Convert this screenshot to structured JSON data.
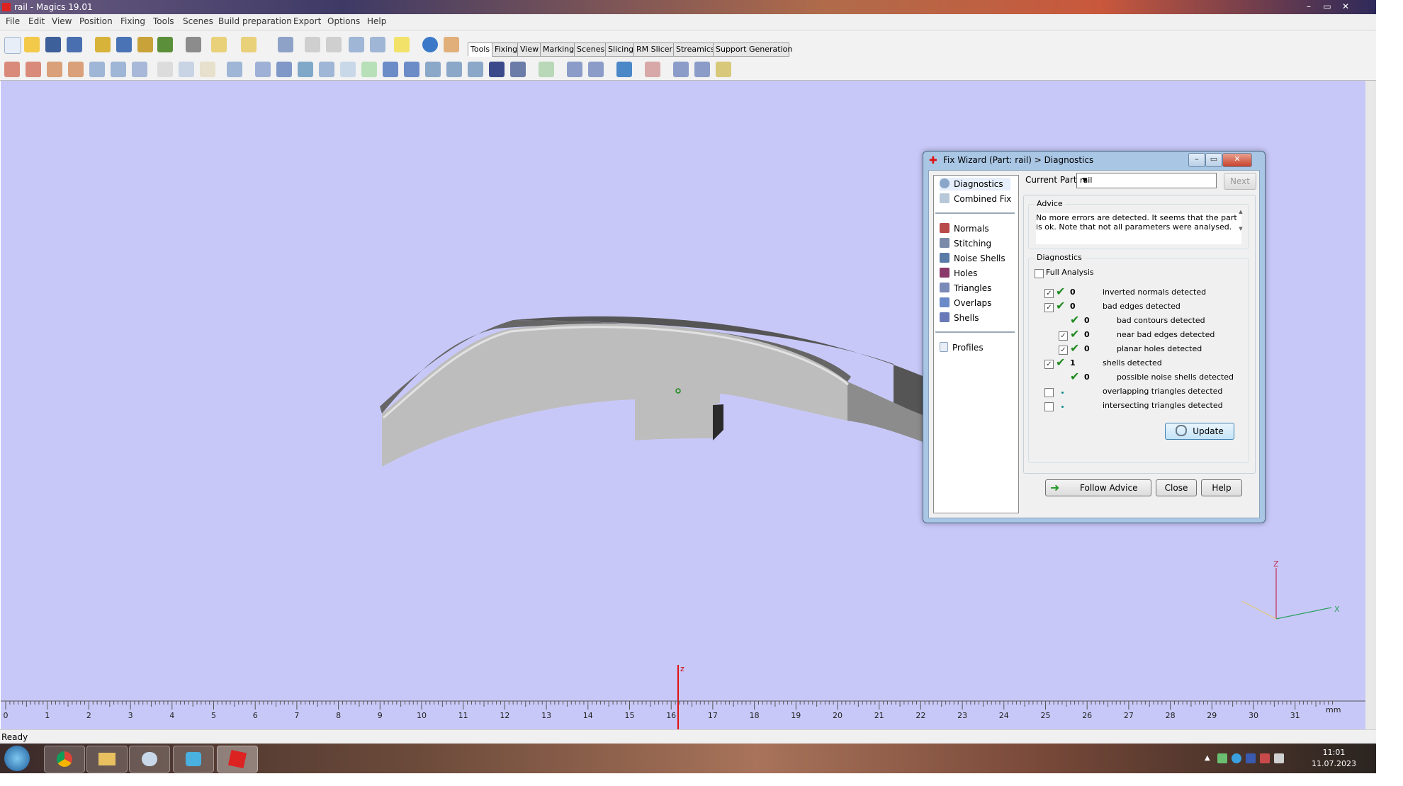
{
  "window": {
    "title": "rail - Magics 19.01"
  },
  "menu": [
    "File",
    "Edit",
    "View",
    "Position",
    "Fixing",
    "Tools",
    "Scenes",
    "Build preparation",
    "Export",
    "Options",
    "Help"
  ],
  "tabs": [
    "Tools",
    "Fixing",
    "View",
    "Marking",
    "Scenes",
    "Slicing",
    "RM Slicer",
    "Streamics",
    "Support Generation"
  ],
  "viewport": {
    "axis_label": "z",
    "triad": {
      "z": "Z",
      "x": "X"
    },
    "ruler_ticks": [
      "0",
      "1",
      "2",
      "3",
      "4",
      "5",
      "6",
      "7",
      "8",
      "9",
      "10",
      "11",
      "12",
      "13",
      "14",
      "15",
      "16",
      "17",
      "18",
      "19",
      "20",
      "21",
      "22",
      "23",
      "24",
      "25",
      "26",
      "27",
      "28",
      "29",
      "30",
      "31"
    ],
    "ruler_unit": "mm"
  },
  "status": {
    "text": "Ready"
  },
  "clock": {
    "time": "11:01",
    "date": "11.07.2023"
  },
  "dialog": {
    "title": "Fix Wizard (Part: rail) > Diagnostics",
    "nav": {
      "top": [
        "Diagnostics",
        "Combined Fix"
      ],
      "tools": [
        "Normals",
        "Stitching",
        "Noise Shells",
        "Holes",
        "Triangles",
        "Overlaps",
        "Shells"
      ],
      "bottom": [
        "Profiles"
      ]
    },
    "current_part_label": "Current Part:",
    "current_part_value": "rail",
    "next_label": "Next",
    "advice_title": "Advice",
    "advice_text": "No more errors are detected. It seems that the part is ok. Note that not all parameters were analysed.",
    "diagnostics_title": "Diagnostics",
    "full_analysis_label": "Full Analysis",
    "rows": [
      {
        "checked": true,
        "count": "0",
        "label": "inverted normals detected",
        "level": 0,
        "status": "ok"
      },
      {
        "checked": true,
        "count": "0",
        "label": "bad edges detected",
        "level": 0,
        "status": "ok"
      },
      {
        "checked": null,
        "count": "0",
        "label": "bad contours detected",
        "level": 1,
        "status": "ok"
      },
      {
        "checked": true,
        "count": "0",
        "label": "near bad edges detected",
        "level": 1,
        "status": "ok"
      },
      {
        "checked": true,
        "count": "0",
        "label": "planar holes detected",
        "level": 1,
        "status": "ok"
      },
      {
        "checked": true,
        "count": "1",
        "label": "shells detected",
        "level": 0,
        "status": "ok"
      },
      {
        "checked": null,
        "count": "0",
        "label": "possible noise shells detected",
        "level": 1,
        "status": "ok"
      },
      {
        "checked": false,
        "count": "",
        "label": "overlapping triangles detected",
        "level": 0,
        "status": "none"
      },
      {
        "checked": false,
        "count": "",
        "label": "intersecting triangles detected",
        "level": 0,
        "status": "none"
      }
    ],
    "update_label": "Update",
    "follow_advice_label": "Follow Advice",
    "close_label": "Close",
    "help_label": "Help"
  }
}
